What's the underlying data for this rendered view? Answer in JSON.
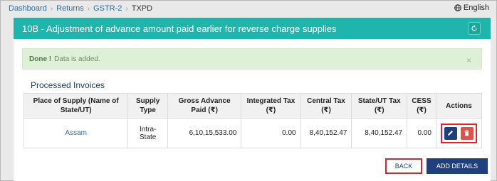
{
  "breadcrumb": {
    "items": [
      "Dashboard",
      "Returns",
      "GSTR-2"
    ],
    "current": "TXPD"
  },
  "language": {
    "label": "English"
  },
  "card": {
    "title": "10B - Adjustment of advance amount paid earlier for reverse charge supplies"
  },
  "alert": {
    "strong": "Done !",
    "message": "Data is added.",
    "close": "×"
  },
  "section": {
    "title": "Processed Invoices"
  },
  "table": {
    "headers": [
      "Place of Supply (Name of State/UT)",
      "Supply Type",
      "Gross Advance Paid (₹)",
      "Integrated Tax (₹)",
      "Central Tax (₹)",
      "State/UT Tax (₹)",
      "CESS (₹)",
      "Actions"
    ],
    "rows": [
      {
        "place": "Assam",
        "supply_type": "Intra-State",
        "gross": "6,10,15,533.00",
        "igst": "0.00",
        "cgst": "8,40,152.47",
        "sgst": "8,40,152.47",
        "cess": "0.00"
      }
    ]
  },
  "buttons": {
    "back": "BACK",
    "add": "ADD DETAILS"
  },
  "icons": {
    "language": "globe-icon",
    "refresh": "refresh-icon",
    "edit": "pencil-icon",
    "delete": "trash-icon"
  },
  "colors": {
    "header": "#1fb5ac",
    "primary": "#1f3f7d",
    "danger": "#d9534f",
    "highlight": "#d9262e",
    "alert_bg": "#dff0d8"
  }
}
